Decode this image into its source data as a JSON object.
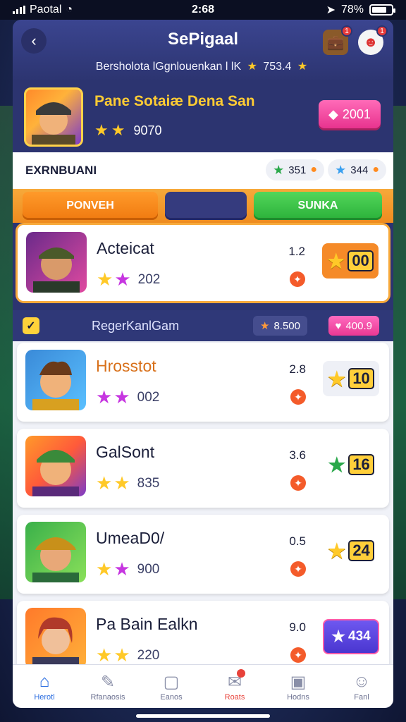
{
  "status_bar": {
    "carrier": "Paotal",
    "time": "2:68",
    "battery": "78%",
    "battery_level": 0.78
  },
  "header": {
    "title": "SePigaal",
    "subtitle": "Bersholota lGgnlouenkan l lK",
    "subtitle_value": "753.4",
    "chest_badge": "1",
    "avatar_badge": "1"
  },
  "profile": {
    "name": "Pane Sotaiæ Dena San",
    "score": "9070",
    "button_value": "2001"
  },
  "filter": {
    "label": "EXRNBUANI",
    "chip1_value": "351",
    "chip2_value": "344"
  },
  "tabs": [
    {
      "label": "PONVEH"
    },
    {
      "label": ""
    },
    {
      "label": "SUNKA"
    }
  ],
  "featured": {
    "name": "Acteicat",
    "stars_value": "202",
    "metric": "1.2",
    "score": "00"
  },
  "section": {
    "title": "RegerKanlGam",
    "chip1_value": "8.500",
    "chip2_value": "400.9"
  },
  "rows": [
    {
      "name": "Hrosstot",
      "stars_value": "002",
      "metric": "2.8",
      "score": "10"
    },
    {
      "name": "GalSont",
      "stars_value": "835",
      "metric": "3.6",
      "score": "16"
    },
    {
      "name": "UmeaD0/",
      "stars_value": "900",
      "metric": "0.5",
      "score": "24"
    },
    {
      "name": "Pa Bain Ealkn",
      "stars_value": "220",
      "metric": "9.0",
      "score": "434"
    }
  ],
  "nav": [
    {
      "label": "Herotl"
    },
    {
      "label": "Rfanaosis"
    },
    {
      "label": "Eanos"
    },
    {
      "label": "Roats"
    },
    {
      "label": "Hodns"
    },
    {
      "label": "Fanl"
    }
  ]
}
